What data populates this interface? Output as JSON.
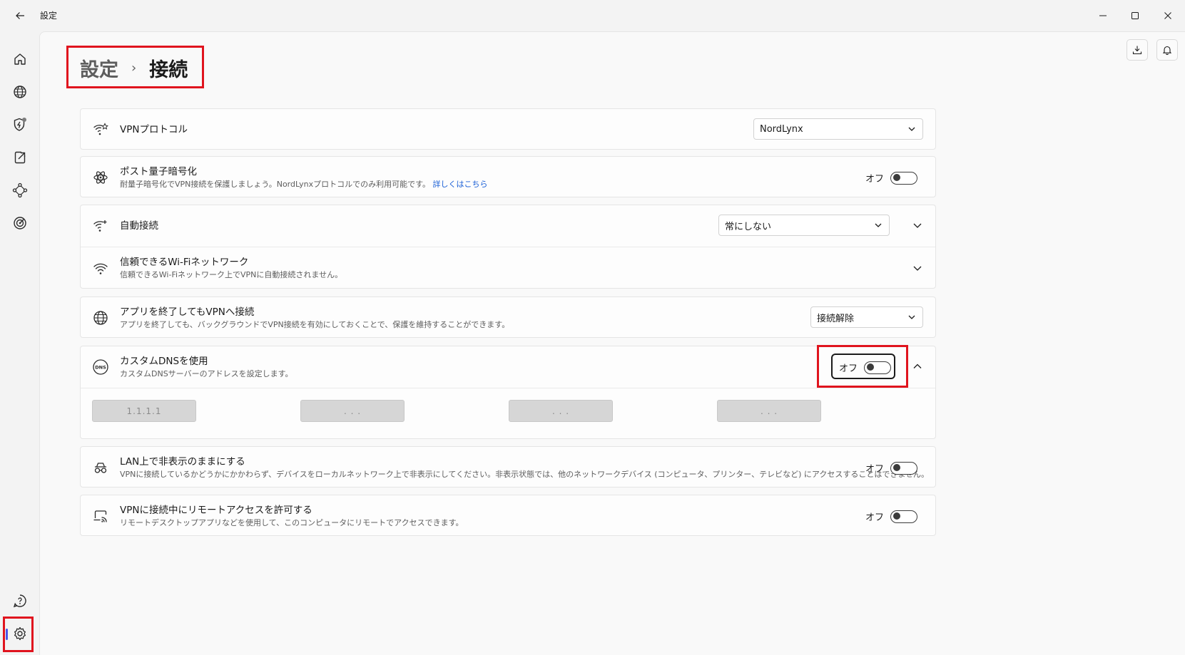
{
  "window": {
    "title": "設定",
    "back_icon": "arrow-left-icon",
    "minimize_icon": "minimize-icon",
    "maximize_icon": "maximize-icon",
    "close_icon": "close-icon"
  },
  "sidebar": {
    "items": [
      {
        "name": "home",
        "icon": "home-icon"
      },
      {
        "name": "globe",
        "icon": "globe-icon"
      },
      {
        "name": "threat-protection",
        "icon": "shield-icon"
      },
      {
        "name": "file-share",
        "icon": "file-share-icon"
      },
      {
        "name": "meshnet",
        "icon": "meshnet-icon"
      },
      {
        "name": "dark-web-monitor",
        "icon": "target-icon"
      }
    ],
    "bottom": [
      {
        "name": "help",
        "icon": "help-icon"
      },
      {
        "name": "settings",
        "icon": "gear-icon"
      }
    ],
    "accent_color": "#4b55e8"
  },
  "header": {
    "breadcrumb_root": "設定",
    "breadcrumb_current": "接続",
    "download_icon": "download-icon",
    "bell_icon": "bell-icon"
  },
  "settings": {
    "vpn_protocol": {
      "title": "VPNプロトコル",
      "value": "NordLynx"
    },
    "post_quantum": {
      "title": "ポスト量子暗号化",
      "desc": "耐量子暗号化でVPN接続を保護しましょう。NordLynxプロトコルでのみ利用可能です。",
      "link": "詳しくはこちら",
      "toggle_label": "オフ"
    },
    "auto_connect": {
      "title": "自動接続",
      "value": "常にしない"
    },
    "trusted_wifi": {
      "title": "信頼できるWi-Fiネットワーク",
      "desc": "信頼できるWi-Fiネットワーク上でVPNに自動接続されません。"
    },
    "stay_connected": {
      "title": "アプリを終了してもVPNへ接続",
      "desc": "アプリを終了しても、バックグラウンドでVPN接続を有効にしておくことで、保護を維持することができます。",
      "value": "接続解除"
    },
    "custom_dns": {
      "title": "カスタムDNSを使用",
      "desc": "カスタムDNSサーバーのアドレスを設定します。",
      "toggle_label": "オフ",
      "fields": [
        "1.1.1.1",
        ". . .",
        ". . .",
        ". . ."
      ]
    },
    "invisible_lan": {
      "title": "LAN上で非表示のままにする",
      "desc": "VPNに接続しているかどうかにかかわらず、デバイスをローカルネットワーク上で非表示にしてください。非表示状態では、他のネットワークデバイス (コンピュータ、プリンター、テレビなど) にアクセスすることはできません。",
      "toggle_label": "オフ"
    },
    "remote_access": {
      "title": "VPNに接続中にリモートアクセスを許可する",
      "desc": "リモートデスクトップアプリなどを使用して、このコンピュータにリモートでアクセスできます。",
      "toggle_label": "オフ"
    }
  },
  "highlight_color": "#e0141e"
}
